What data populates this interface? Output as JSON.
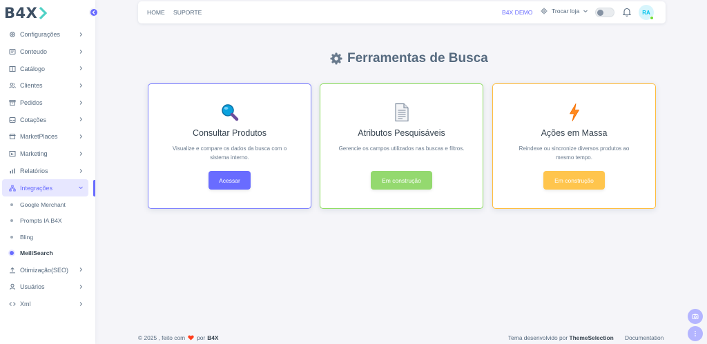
{
  "brand": {
    "logo_text": "B4X",
    "accent": "#696cff"
  },
  "sidebar": {
    "items": [
      {
        "label": "Configurações",
        "icon": "gear-icon"
      },
      {
        "label": "Conteudo",
        "icon": "content-icon"
      },
      {
        "label": "Catálogo",
        "icon": "book-icon"
      },
      {
        "label": "Clientes",
        "icon": "users-icon"
      },
      {
        "label": "Pedidos",
        "icon": "archive-icon"
      },
      {
        "label": "Cotações",
        "icon": "inbox-icon"
      },
      {
        "label": "MarketPlaces",
        "icon": "store-icon"
      },
      {
        "label": "Marketing",
        "icon": "campaign-icon"
      },
      {
        "label": "Relatórios",
        "icon": "bar-chart-icon"
      },
      {
        "label": "Integrações",
        "icon": "sitemap-icon"
      }
    ],
    "sub_items": [
      {
        "label": "Google Merchant"
      },
      {
        "label": "Prompts IA B4X"
      },
      {
        "label": "Bling"
      },
      {
        "label": "MeiliSearch"
      }
    ],
    "items_after": [
      {
        "label": "Otimização(SEO)",
        "icon": "upload-icon"
      },
      {
        "label": "Usuários",
        "icon": "user-icon"
      },
      {
        "label": "Xml",
        "icon": "code-icon"
      }
    ]
  },
  "navbar": {
    "home": "HOME",
    "support": "SUPORTE",
    "store_name": "B4X DEMO",
    "switch_store": "Trocar loja",
    "avatar_initials": "RA"
  },
  "page": {
    "title": "Ferramentas de Busca"
  },
  "cards": [
    {
      "title": "Consultar Produtos",
      "description": "Visualize e compare os dados da busca com o sistema interno.",
      "button": "Acessar",
      "border_color": "#696cff",
      "button_color": "#696cff",
      "icon": "magnifier-icon"
    },
    {
      "title": "Atributos Pesquisáveis",
      "description": "Gerencie os campos utilizados nas buscas e filtros.",
      "button": "Em construção",
      "border_color": "#71dd37",
      "button_color": "#94d96f",
      "icon": "document-icon"
    },
    {
      "title": "Ações em Massa",
      "description": "Reindexe ou sincronize diversos produtos ao mesmo tempo.",
      "button": "Em construção",
      "border_color": "#ffab00",
      "button_color": "#ffc54d",
      "icon": "lightning-icon"
    }
  ],
  "footer": {
    "copyright": "© 2025 , feito com",
    "by": "por",
    "brand": "B4X",
    "theme_prefix": "Tema desenvolvido por",
    "theme_author": "ThemeSelection",
    "documentation": "Documentation"
  }
}
